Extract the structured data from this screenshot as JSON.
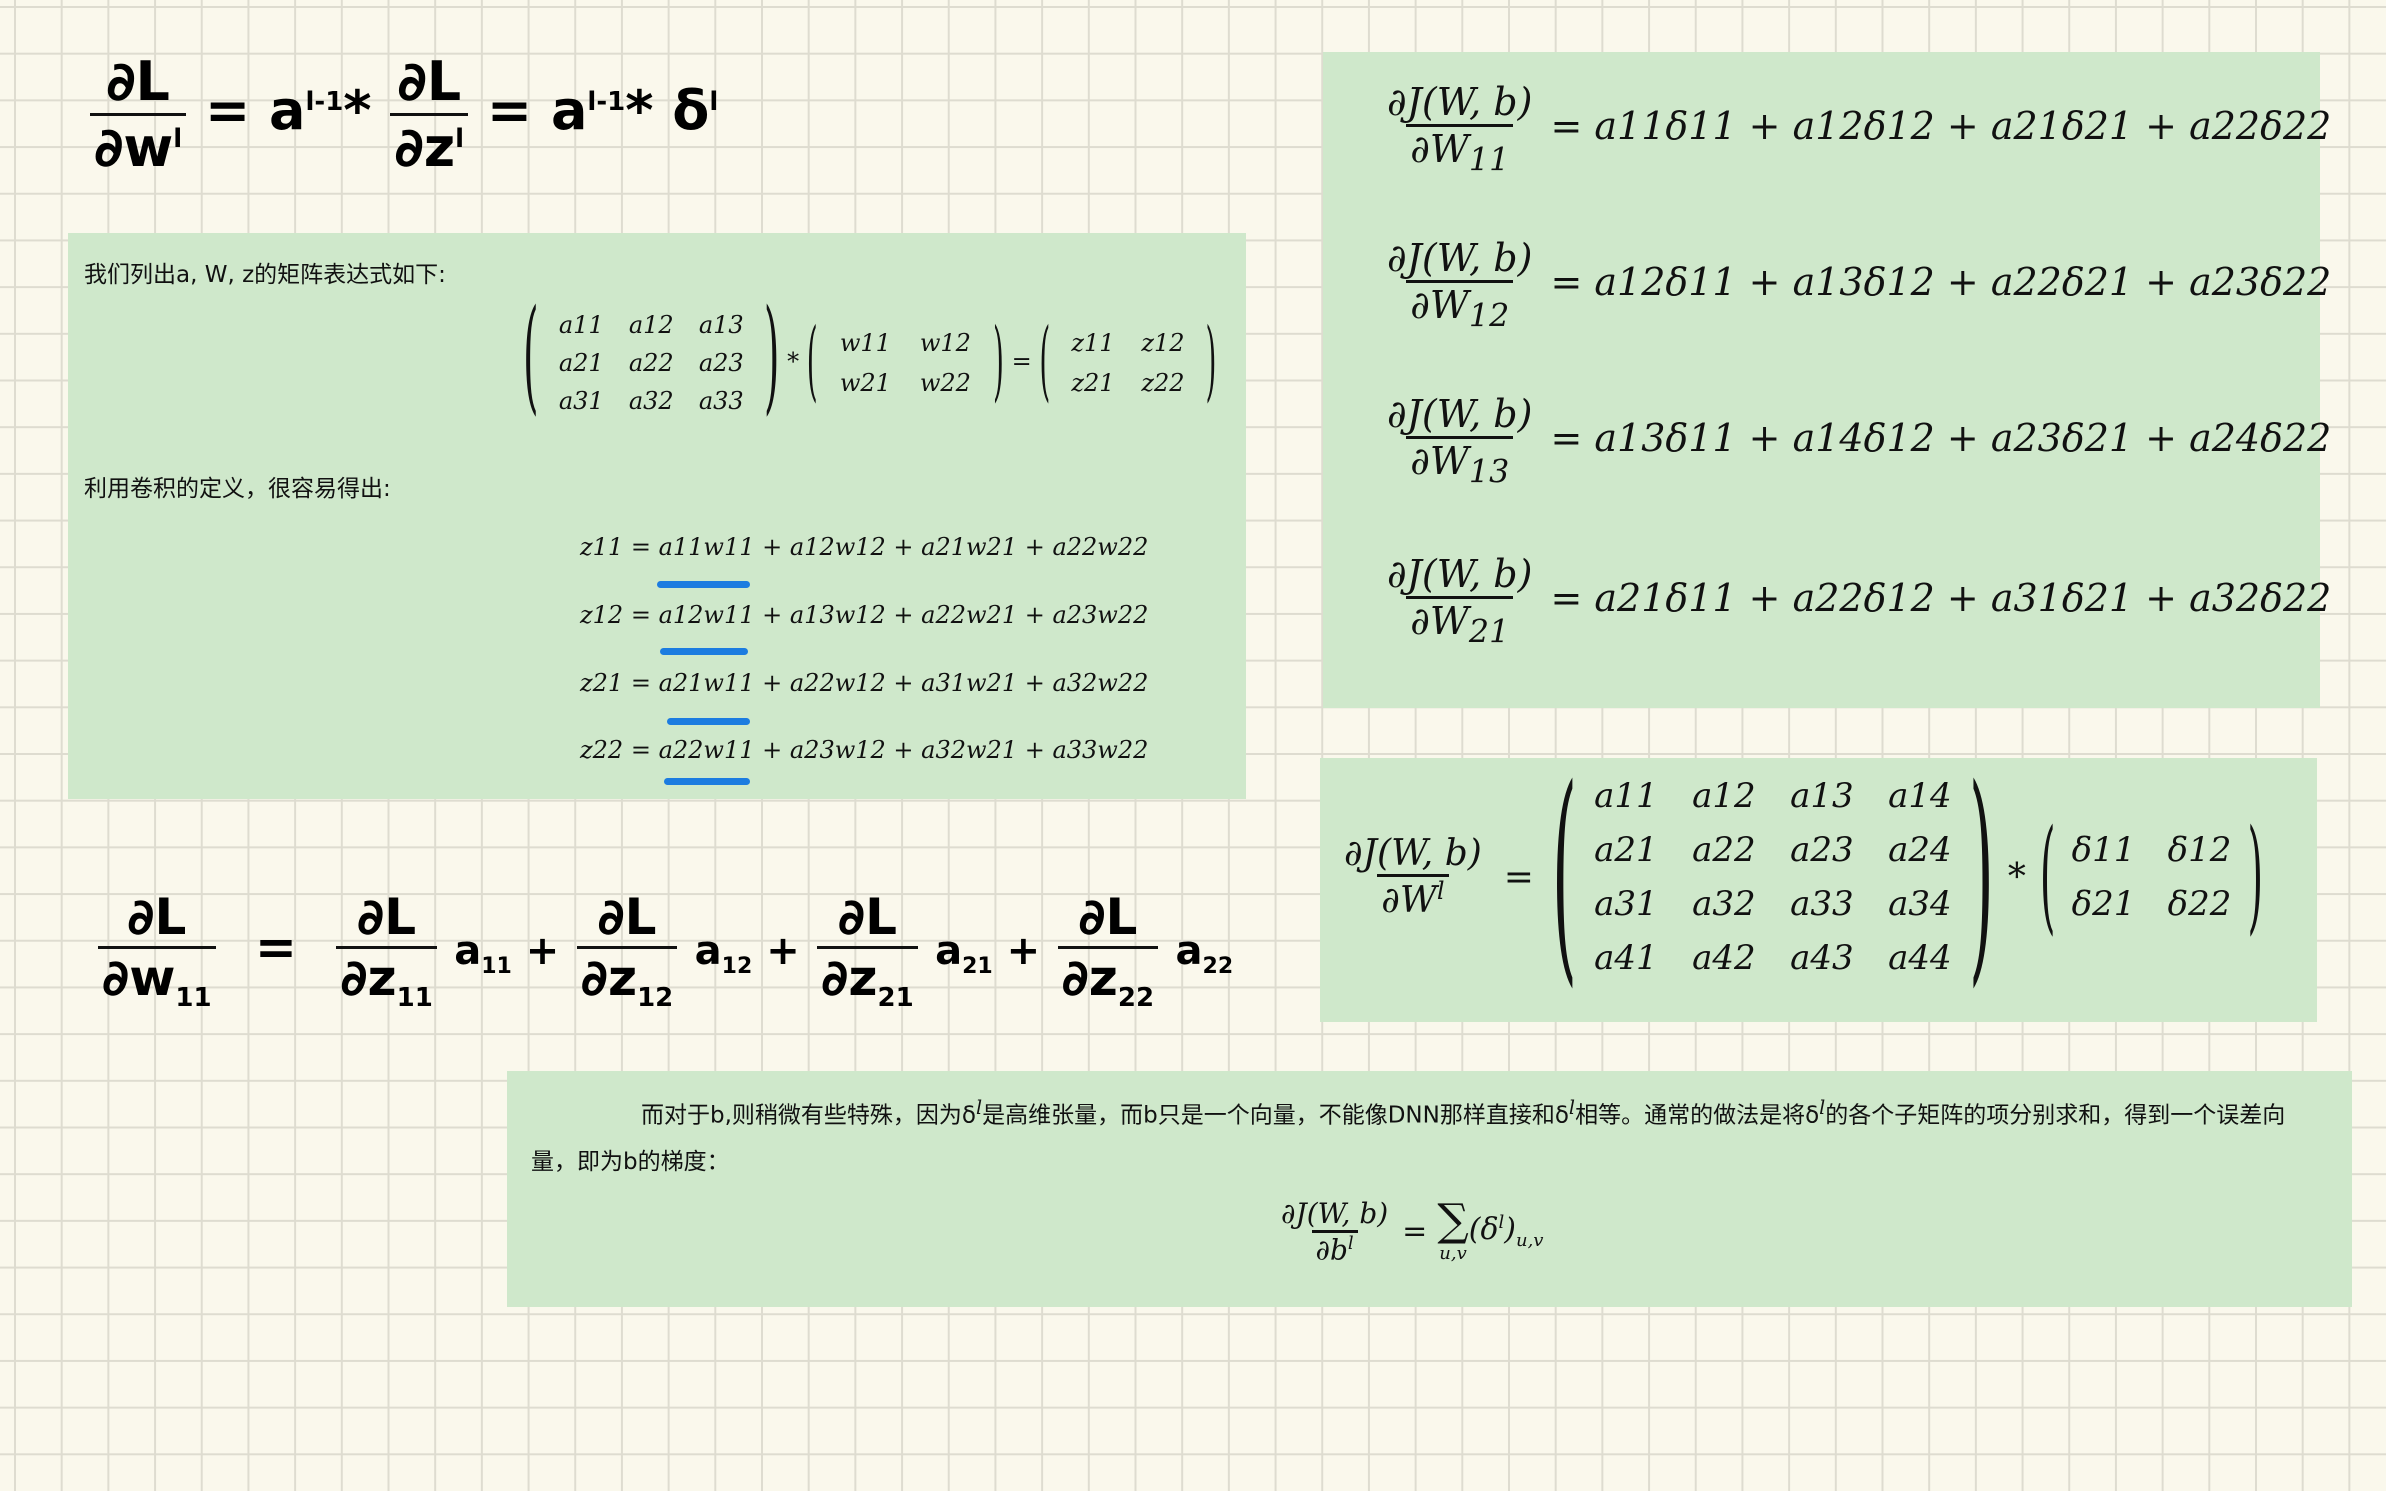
{
  "handwritten": {
    "top_formula": "∂L/∂w^l = a^(l-1) * ∂L/∂z^l = a^(l-1) * δ^l",
    "bottom_formula": "∂L/∂w11 = ∂L/∂z11 a11 + ∂L/∂z12 a12 + ∂L/∂z21 a21 + ∂L/∂z22 a22"
  },
  "left_panel": {
    "intro": "我们列出a, W, z的矩阵表达式如下:",
    "conv_text": "利用卷积的定义，很容易得出:",
    "a_matrix": [
      [
        "a11",
        "a12",
        "a13"
      ],
      [
        "a21",
        "a22",
        "a23"
      ],
      [
        "a31",
        "a32",
        "a33"
      ]
    ],
    "w_matrix": [
      [
        "w11",
        "w12"
      ],
      [
        "w21",
        "w22"
      ]
    ],
    "z_matrix": [
      [
        "z11",
        "z12"
      ],
      [
        "z21",
        "z22"
      ]
    ],
    "equations": [
      {
        "lhs": "z11",
        "rhs": "a11w11 + a12w12 + a21w21 + a22w22"
      },
      {
        "lhs": "z12",
        "rhs": "a12w11 + a13w12 + a22w21 + a23w22"
      },
      {
        "lhs": "z21",
        "rhs": "a21w11 + a22w12 + a31w21 + a32w22"
      },
      {
        "lhs": "z22",
        "rhs": "a22w11 + a23w12 + a32w21 + a33w22"
      }
    ],
    "underline_color": "#1c7ce0"
  },
  "right_top_panel": {
    "numerator": "∂J(W, b)",
    "rows": [
      {
        "den": "∂W",
        "sub": "11",
        "rhs": "= a11δ11 + a12δ12 + a21δ21 + a22δ22"
      },
      {
        "den": "∂W",
        "sub": "12",
        "rhs": "= a12δ11 + a13δ12 + a22δ21 + a23δ22"
      },
      {
        "den": "∂W",
        "sub": "13",
        "rhs": "= a13δ11 + a14δ12 + a23δ21 + a24δ22"
      },
      {
        "den": "∂W",
        "sub": "21",
        "rhs": "= a21δ11 + a22δ12 + a31δ21 + a32δ22"
      }
    ]
  },
  "right_mid_panel": {
    "numerator": "∂J(W, b)",
    "denominator": "∂W",
    "a_matrix": [
      [
        "a11",
        "a12",
        "a13",
        "a14"
      ],
      [
        "a21",
        "a22",
        "a23",
        "a24"
      ],
      [
        "a31",
        "a32",
        "a33",
        "a34"
      ],
      [
        "a41",
        "a42",
        "a43",
        "a44"
      ]
    ],
    "d_matrix": [
      [
        "δ11",
        "δ12"
      ],
      [
        "δ21",
        "δ22"
      ]
    ]
  },
  "bottom_panel": {
    "text_1": "而对于b,则稍微有些特殊，因为δ",
    "text_2": "是高维张量，而b只是一个向量，不能像DNN那样直接和δ",
    "text_3": "相等。通常的做法是将δ",
    "text_4": "的各个子矩阵的项分别求和，得到一个误差向量，即为b的梯度：",
    "numerator": "∂J(W, b)",
    "denominator": "∂b",
    "rhs": "(δ",
    "rhs_tail": ")",
    "sum_sub": "u,v",
    "rhs_sub": "u,v"
  },
  "colors": {
    "panel": "#cfe8cb",
    "paper": "#faf8ec",
    "grid": "#dedcd0"
  }
}
